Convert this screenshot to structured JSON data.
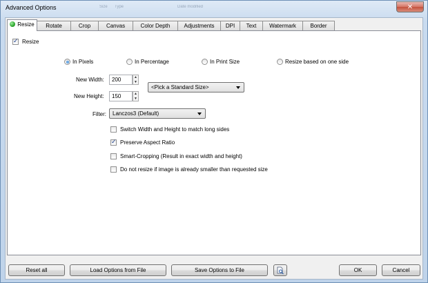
{
  "window": {
    "title": "Advanced Options",
    "ghost_texts": [
      "Size",
      "Type",
      "Date modified"
    ]
  },
  "tabs": [
    {
      "label": "Resize",
      "active": true
    },
    {
      "label": "Rotate"
    },
    {
      "label": "Crop"
    },
    {
      "label": "Canvas"
    },
    {
      "label": "Color Depth"
    },
    {
      "label": "Adjustments"
    },
    {
      "label": "DPI"
    },
    {
      "label": "Text"
    },
    {
      "label": "Watermark"
    },
    {
      "label": "Border"
    }
  ],
  "resize": {
    "enable_label": "Resize",
    "enabled": true,
    "modes": [
      {
        "label": "In Pixels",
        "selected": true
      },
      {
        "label": "In Percentage",
        "selected": false
      },
      {
        "label": "In Print Size",
        "selected": false
      },
      {
        "label": "Resize based on one side",
        "selected": false
      }
    ],
    "new_width_label": "New Width:",
    "new_width_value": "200",
    "new_height_label": "New Height:",
    "new_height_value": "150",
    "standard_size_selected": "<Pick a Standard Size>",
    "filter_label": "Filter:",
    "filter_selected": "Lanczos3 (Default)",
    "options": [
      {
        "label": "Switch Width and Height to match long sides",
        "checked": false
      },
      {
        "label": "Preserve Aspect Ratio",
        "checked": true
      },
      {
        "label": "Smart-Cropping (Result in exact width and height)",
        "checked": false
      },
      {
        "label": "Do not resize if image is already smaller than requested size",
        "checked": false
      }
    ]
  },
  "footer": {
    "reset_label": "Reset all",
    "load_label": "Load Options from File",
    "save_label": "Save Options to File",
    "ok_label": "OK",
    "cancel_label": "Cancel"
  },
  "colors": {
    "title_bar": "#c9dbef",
    "close_button": "#c4513c",
    "active_tab_dot": "#1e9a1e"
  }
}
